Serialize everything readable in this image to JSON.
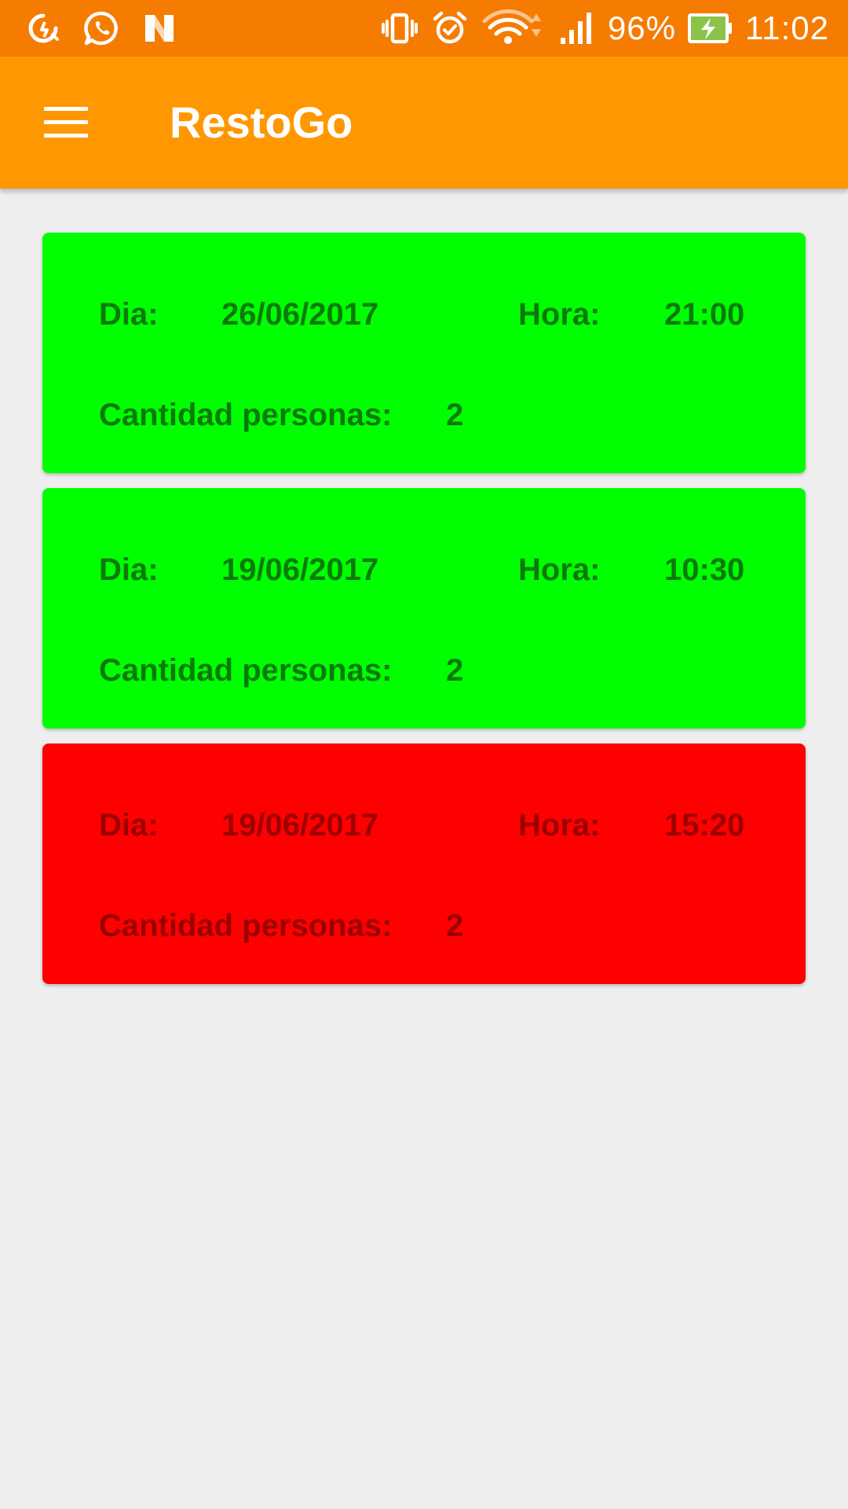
{
  "status_bar": {
    "left_icons": [
      "data-saver-icon",
      "whatsapp-icon",
      "n-app-icon"
    ],
    "right_icons": [
      "vibrate-icon",
      "alarm-icon",
      "wifi-icon",
      "signal-icon",
      "battery-charging-icon"
    ],
    "battery": "96%",
    "time": "11:02",
    "background": "#f57c00"
  },
  "app_bar": {
    "title": "RestoGo",
    "menu_icon": "hamburger-menu-icon",
    "background": "#ff9800"
  },
  "labels": {
    "day": "Dia:",
    "hour": "Hora:",
    "people": "Cantidad personas:"
  },
  "reservations": [
    {
      "date": "26/06/2017",
      "time": "21:00",
      "people": "2",
      "status_color": "#00ff00"
    },
    {
      "date": "19/06/2017",
      "time": "10:30",
      "people": "2",
      "status_color": "#00ff00"
    },
    {
      "date": "19/06/2017",
      "time": "15:20",
      "people": "2",
      "status_color": "#ff0000"
    }
  ]
}
